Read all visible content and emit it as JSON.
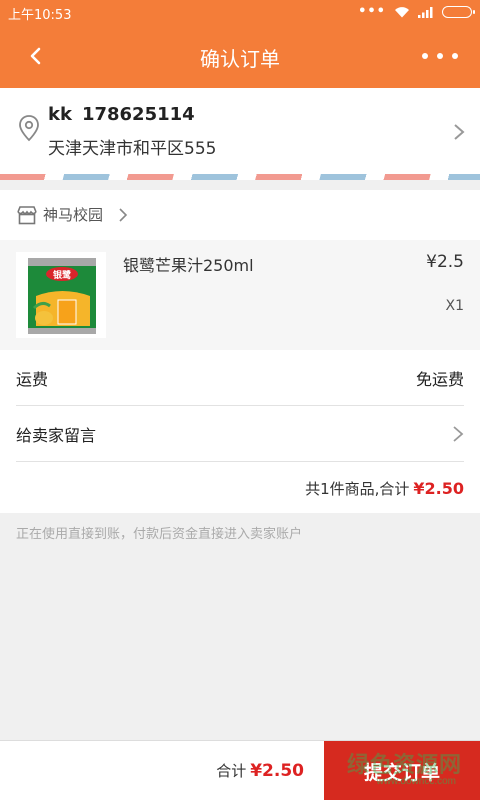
{
  "status_bar": {
    "time": "上午10:53"
  },
  "header": {
    "title": "确认订单",
    "back_icon": "chevron-left-icon",
    "more_icon": "more-dots-icon",
    "color": "#f47d39"
  },
  "address": {
    "name": "kk",
    "phone": "178625114",
    "detail": "天津天津市和平区555"
  },
  "shop": {
    "name": "神马校园"
  },
  "product": {
    "name": "银鹭芒果汁250ml",
    "price": "¥2.5",
    "quantity": "X1",
    "thumb_text": "银鹭"
  },
  "shipping": {
    "label": "运费",
    "value": "免运费"
  },
  "message": {
    "label": "给卖家留言"
  },
  "summary": {
    "text": "共1件商品,合计",
    "amount": "¥2.50"
  },
  "notice": "正在使用直接到账，付款后资金直接进入卖家账户",
  "footer": {
    "total_label": "合计",
    "total_amount": "¥2.50",
    "submit_label": "提交订单",
    "submit_color": "#d62a1f"
  },
  "watermark": {
    "text": "绿色资源网",
    "url": "www.downcc.com"
  }
}
